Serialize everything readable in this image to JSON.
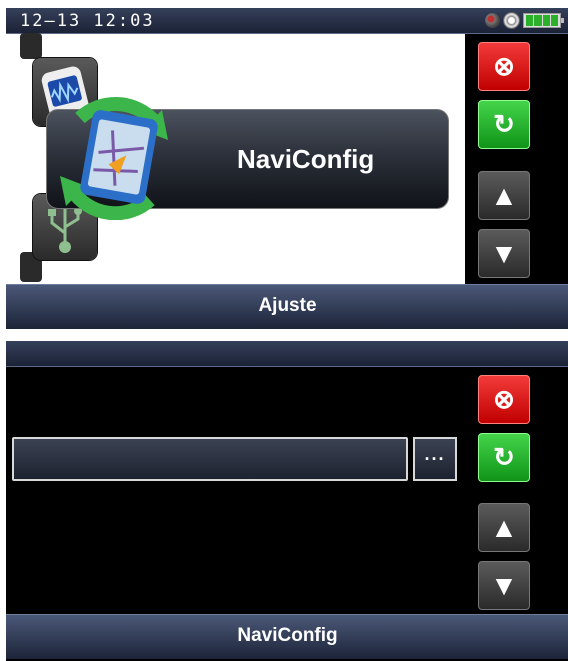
{
  "top_screen": {
    "status_time": "12–13  12:03",
    "main_item_label": "NaviConfig",
    "title_bar": "Ajuste",
    "icons": {
      "status": [
        "gps-icon",
        "disc-icon",
        "battery-icon"
      ],
      "carousel": [
        "audio-player-icon",
        "naviconfig-icon",
        "usb-icon"
      ]
    }
  },
  "bottom_screen": {
    "path_value": "",
    "browse_label": "···",
    "title_bar": "NaviConfig"
  },
  "buttons": {
    "cancel": "⊗",
    "refresh": "↻",
    "up": "▲",
    "down": "▼"
  },
  "colors": {
    "cancel_red": "#d81010",
    "refresh_green": "#22b52a",
    "title_bar_blue": "#2c3650"
  }
}
